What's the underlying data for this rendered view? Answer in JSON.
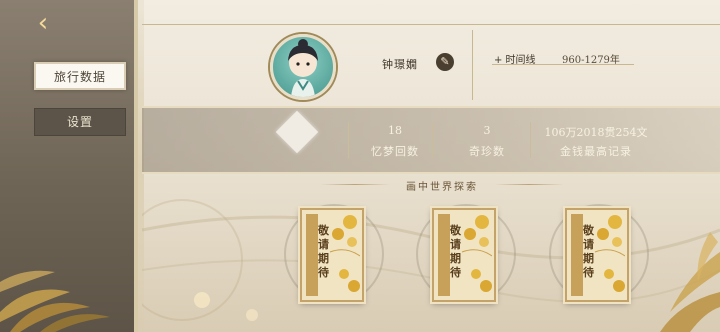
{
  "sidebar": {
    "back_icon": "chevron-left-icon",
    "items": [
      {
        "label": "旅行数据",
        "active": true
      },
      {
        "label": "设置",
        "active": false
      }
    ]
  },
  "profile": {
    "name": "钟璟嫺",
    "edit_icon": "pencil-icon",
    "timeline_label": "+ 时间线",
    "timeline_value": "960-1279年"
  },
  "stats": [
    {
      "value": "18",
      "label": "忆梦回数"
    },
    {
      "value": "3",
      "label": "奇珍数"
    },
    {
      "value": "106万2018贯254文",
      "label": "金钱最高记录"
    }
  ],
  "section": {
    "title": "画中世界探索"
  },
  "cards": [
    {
      "label": "敬请期待"
    },
    {
      "label": "敬请期待"
    },
    {
      "label": "敬请期待"
    }
  ],
  "colors": {
    "accent": "#c7a05a",
    "sidebar": "#6f6556",
    "paper": "#f2ece1"
  }
}
